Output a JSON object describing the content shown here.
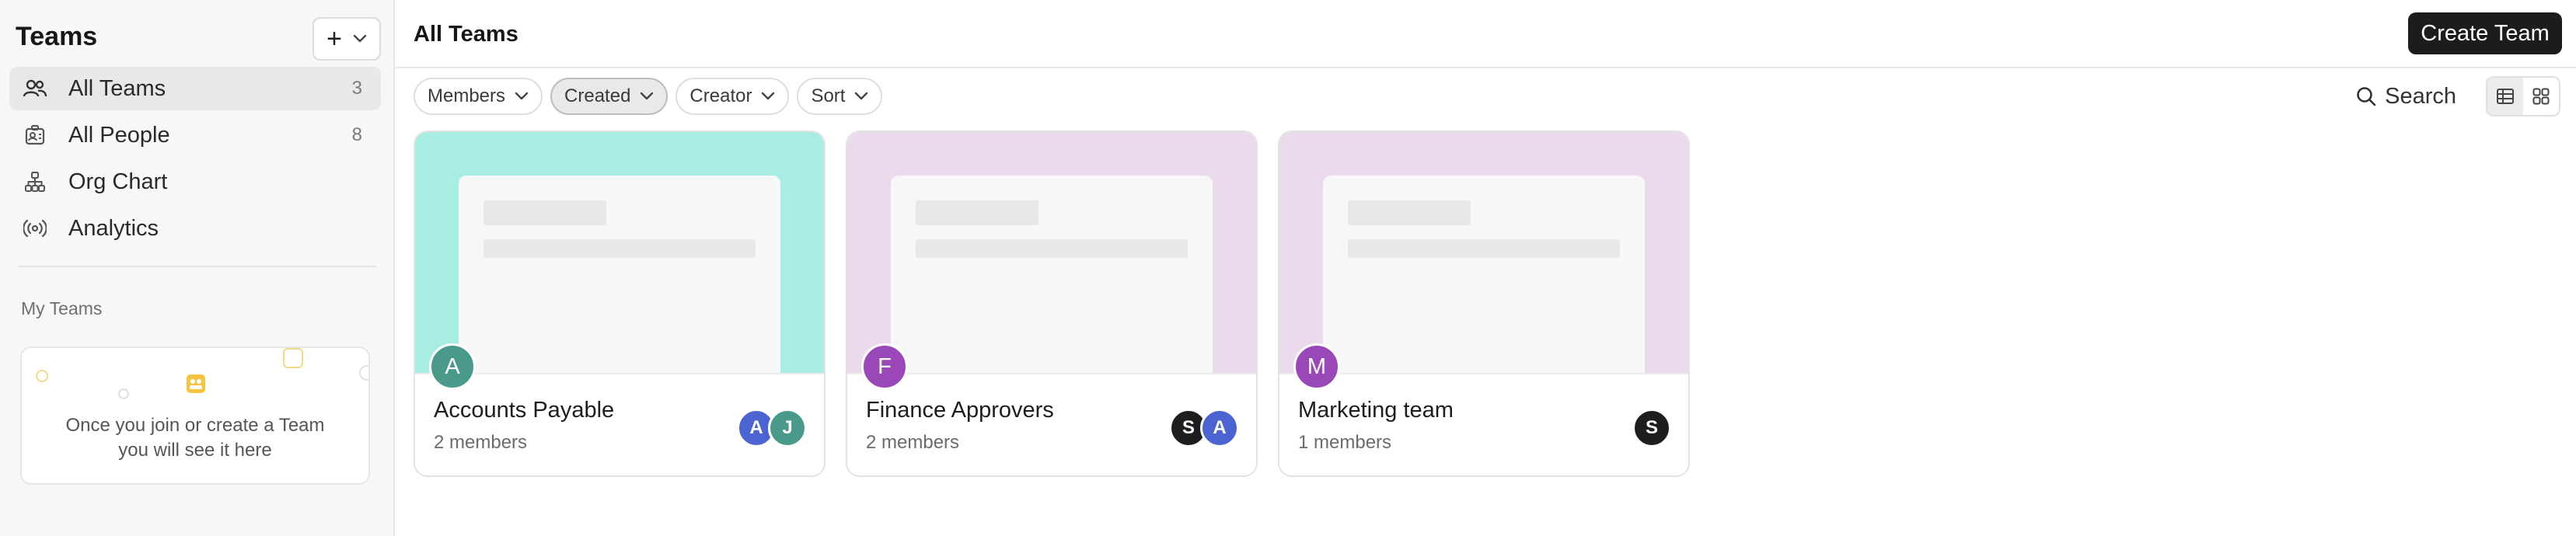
{
  "sidebar": {
    "title": "Teams",
    "add_label": "+",
    "items": [
      {
        "label": "All Teams",
        "count": "3",
        "icon": "teams-icon",
        "active": true
      },
      {
        "label": "All People",
        "count": "8",
        "icon": "people-badge-icon"
      },
      {
        "label": "Org Chart",
        "count": "",
        "icon": "org-chart-icon"
      },
      {
        "label": "Analytics",
        "count": "",
        "icon": "broadcast-icon"
      }
    ],
    "my_teams": {
      "title": "My Teams",
      "empty_text_line1": "Once you join or create a Team",
      "empty_text_line2": "you will see it here"
    }
  },
  "main": {
    "title": "All Teams",
    "create_button": "Create Team",
    "filters": [
      {
        "label": "Members",
        "active": false
      },
      {
        "label": "Created",
        "active": true
      },
      {
        "label": "Creator",
        "active": false
      },
      {
        "label": "Sort",
        "active": false
      }
    ],
    "search_label": "Search",
    "view_mode": "list"
  },
  "teams": [
    {
      "name": "Accounts Payable",
      "members": "2 members",
      "initial": "A",
      "cover_color": "#a8ede2",
      "avatar_color": "#4a9a8c",
      "member_avatars": [
        {
          "initial": "A",
          "color": "#4c63d2"
        },
        {
          "initial": "J",
          "color": "#4a9a8c"
        }
      ]
    },
    {
      "name": "Finance Approvers",
      "members": "2 members",
      "initial": "F",
      "cover_color": "#eadaec",
      "avatar_color": "#9a48b8",
      "member_avatars": [
        {
          "initial": "S",
          "color": "#1e1e1e"
        },
        {
          "initial": "A",
          "color": "#4c63d2"
        }
      ]
    },
    {
      "name": "Marketing team",
      "members": "1 members",
      "initial": "M",
      "cover_color": "#eadaec",
      "avatar_color": "#9a48b8",
      "member_avatars": [
        {
          "initial": "S",
          "color": "#1e1e1e"
        }
      ]
    }
  ]
}
